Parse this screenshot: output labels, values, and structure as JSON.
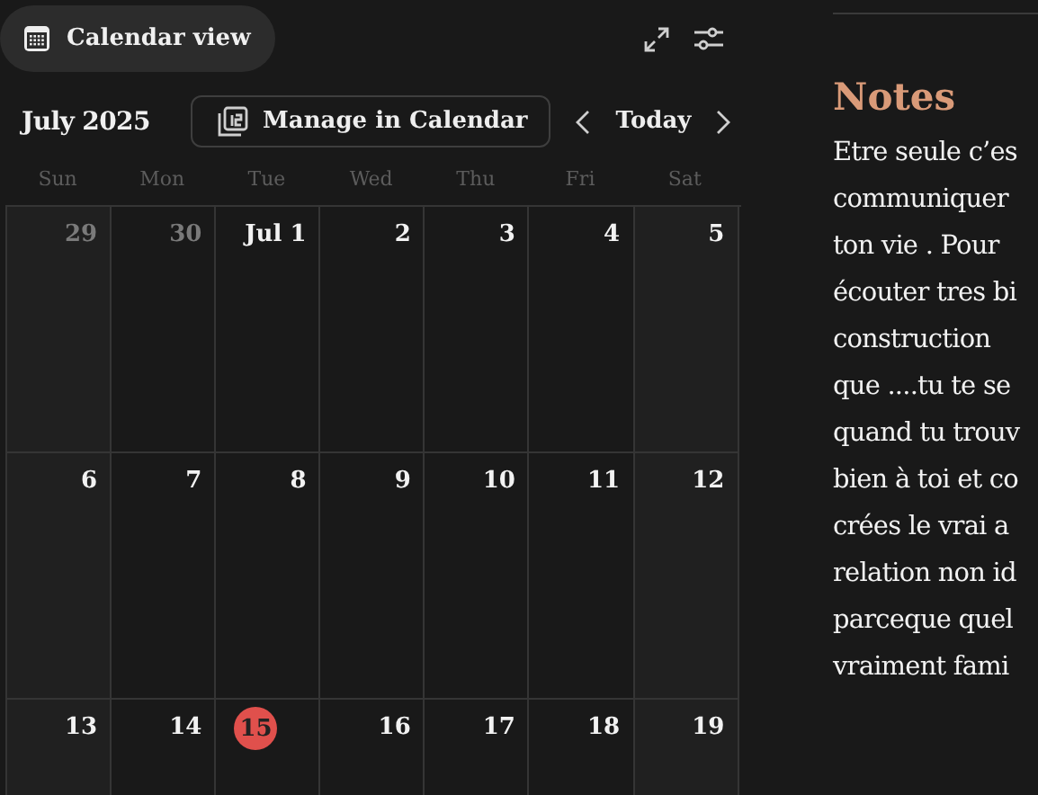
{
  "header": {
    "title": "Calendar view"
  },
  "toolbar": {
    "month": "July 2025",
    "manage_button": "Manage in Calendar",
    "today_button": "Today"
  },
  "weekdays": [
    "Sun",
    "Mon",
    "Tue",
    "Wed",
    "Thu",
    "Fri",
    "Sat"
  ],
  "weeks": [
    [
      {
        "label": "29",
        "other_month": true,
        "today": false
      },
      {
        "label": "30",
        "other_month": true,
        "today": false
      },
      {
        "label": "Jul 1",
        "other_month": false,
        "today": false
      },
      {
        "label": "2",
        "other_month": false,
        "today": false
      },
      {
        "label": "3",
        "other_month": false,
        "today": false
      },
      {
        "label": "4",
        "other_month": false,
        "today": false
      },
      {
        "label": "5",
        "other_month": false,
        "today": false
      }
    ],
    [
      {
        "label": "6",
        "other_month": false,
        "today": false
      },
      {
        "label": "7",
        "other_month": false,
        "today": false
      },
      {
        "label": "8",
        "other_month": false,
        "today": false
      },
      {
        "label": "9",
        "other_month": false,
        "today": false
      },
      {
        "label": "10",
        "other_month": false,
        "today": false
      },
      {
        "label": "11",
        "other_month": false,
        "today": false
      },
      {
        "label": "12",
        "other_month": false,
        "today": false
      }
    ],
    [
      {
        "label": "13",
        "other_month": false,
        "today": false
      },
      {
        "label": "14",
        "other_month": false,
        "today": false
      },
      {
        "label": "15",
        "other_month": false,
        "today": true
      },
      {
        "label": "16",
        "other_month": false,
        "today": false
      },
      {
        "label": "17",
        "other_month": false,
        "today": false
      },
      {
        "label": "18",
        "other_month": false,
        "today": false
      },
      {
        "label": "19",
        "other_month": false,
        "today": false
      }
    ]
  ],
  "notes": {
    "title": "Notes",
    "lines": [
      "Etre seule c’es",
      "communiquer",
      "ton vie . Pour",
      "écouter tres bi",
      "construction",
      "que ....tu te se",
      "quand tu trouv",
      "bien à toi et co",
      "crées le vrai a",
      "relation non id",
      "parceque quel",
      "vraiment fami"
    ]
  }
}
